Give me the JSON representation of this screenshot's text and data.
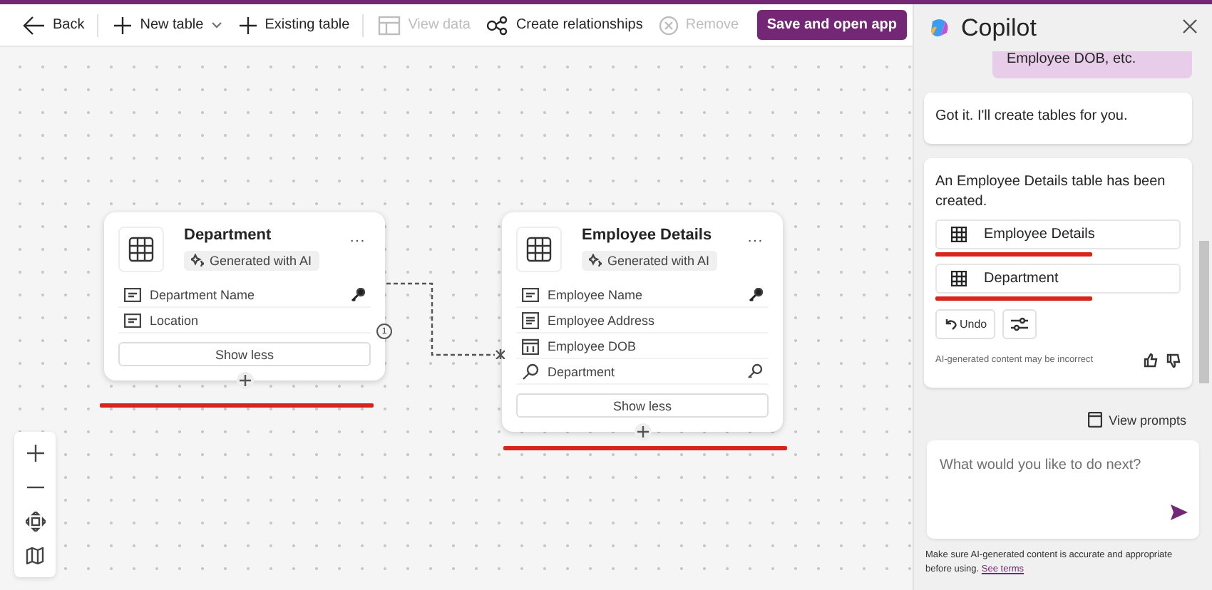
{
  "toolbar": {
    "items": [
      {
        "kind": "back",
        "label": "Back",
        "disabled": false
      },
      {
        "kind": "dropdown",
        "label": "New table",
        "disabled": false
      },
      {
        "kind": "add",
        "label": "Existing table",
        "disabled": false
      },
      {
        "kind": "view",
        "label": "View data",
        "disabled": true
      },
      {
        "kind": "relate",
        "label": "Create relationships",
        "disabled": false
      },
      {
        "kind": "remove",
        "label": "Remove",
        "disabled": true
      },
      {
        "kind": "primary",
        "label": "Save and open app",
        "disabled": false
      }
    ]
  },
  "canvas": {
    "tables": [
      {
        "name": "Department",
        "badge": "Generated with AI",
        "menu": "···",
        "button": "Show less",
        "columns": [
          {
            "name": "Department Name",
            "kind": "text",
            "primary_key": true
          },
          {
            "name": "Location",
            "kind": "text",
            "primary_key": false
          }
        ]
      },
      {
        "name": "Employee Details",
        "badge": "Generated with AI",
        "menu": "···",
        "button": "Show less",
        "columns": [
          {
            "name": "Employee Name",
            "kind": "text",
            "primary_key": true
          },
          {
            "name": "Employee Address",
            "kind": "multiline",
            "primary_key": false
          },
          {
            "name": "Employee DOB",
            "kind": "date",
            "primary_key": false
          },
          {
            "name": "Department",
            "kind": "lookup",
            "primary_key": false
          }
        ]
      }
    ],
    "relationship": {
      "one_label": "1"
    }
  },
  "copilot": {
    "title": "Copilot",
    "messages": [
      {
        "kind": "user",
        "text": "Employee DOB, etc."
      },
      {
        "kind": "assistant",
        "text": "Got it. I'll create tables for you."
      },
      {
        "kind": "assistant",
        "text": "An Employee Details table has been created.",
        "tables": [
          "Employee Details",
          "Department"
        ],
        "undo": "Undo",
        "disclaimer": "AI-generated content may be incorrect"
      }
    ],
    "view_prompts": "View prompts",
    "input": {
      "placeholder": "What would you like to do next?"
    },
    "footer": {
      "text": "Make sure AI-generated content is accurate and appropriate before using.",
      "link": "See terms"
    }
  }
}
